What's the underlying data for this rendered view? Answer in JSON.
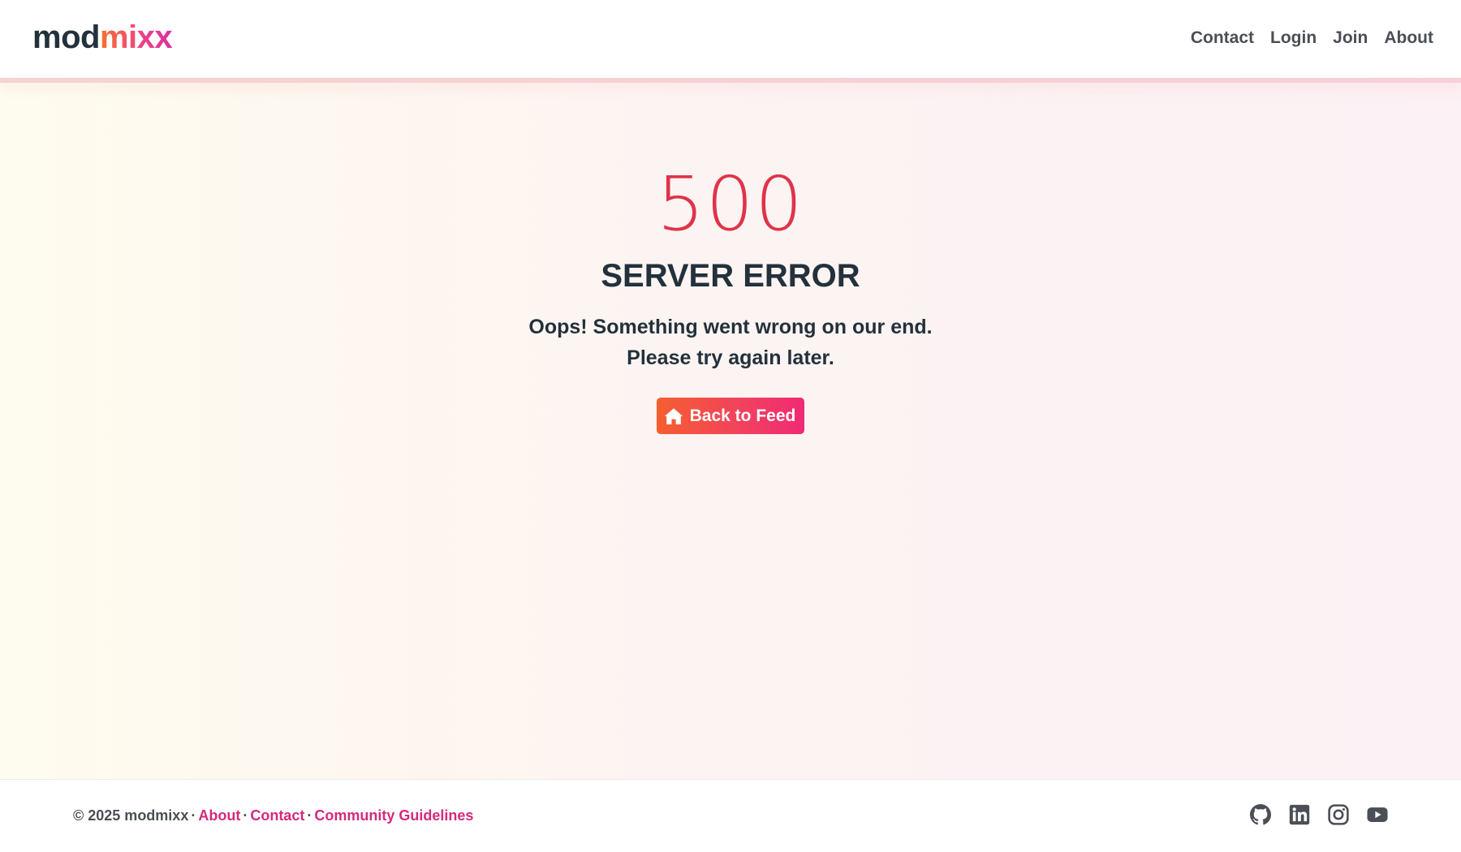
{
  "header": {
    "logo_part1": "mod",
    "logo_part2": "mixx",
    "nav": [
      {
        "label": "Contact"
      },
      {
        "label": "Login"
      },
      {
        "label": "Join"
      },
      {
        "label": "About"
      }
    ]
  },
  "error": {
    "code": "500",
    "title": "SERVER ERROR",
    "message_line1": "Oops! Something went wrong on our end.",
    "message_line2": "Please try again later.",
    "button_label": "Back to Feed",
    "button_icon": "home-icon"
  },
  "footer": {
    "copyright": "© 2025 modmixx",
    "links": [
      {
        "label": "About"
      },
      {
        "label": "Contact"
      },
      {
        "label": "Community Guidelines"
      }
    ],
    "separator": "·",
    "social": [
      "github-icon",
      "linkedin-icon",
      "instagram-icon",
      "youtube-icon"
    ]
  },
  "colors": {
    "accent": "#df3349",
    "link": "#d42a7a",
    "text": "#23313b",
    "button_start": "#f55e2f",
    "button_end": "#ef2a74"
  }
}
